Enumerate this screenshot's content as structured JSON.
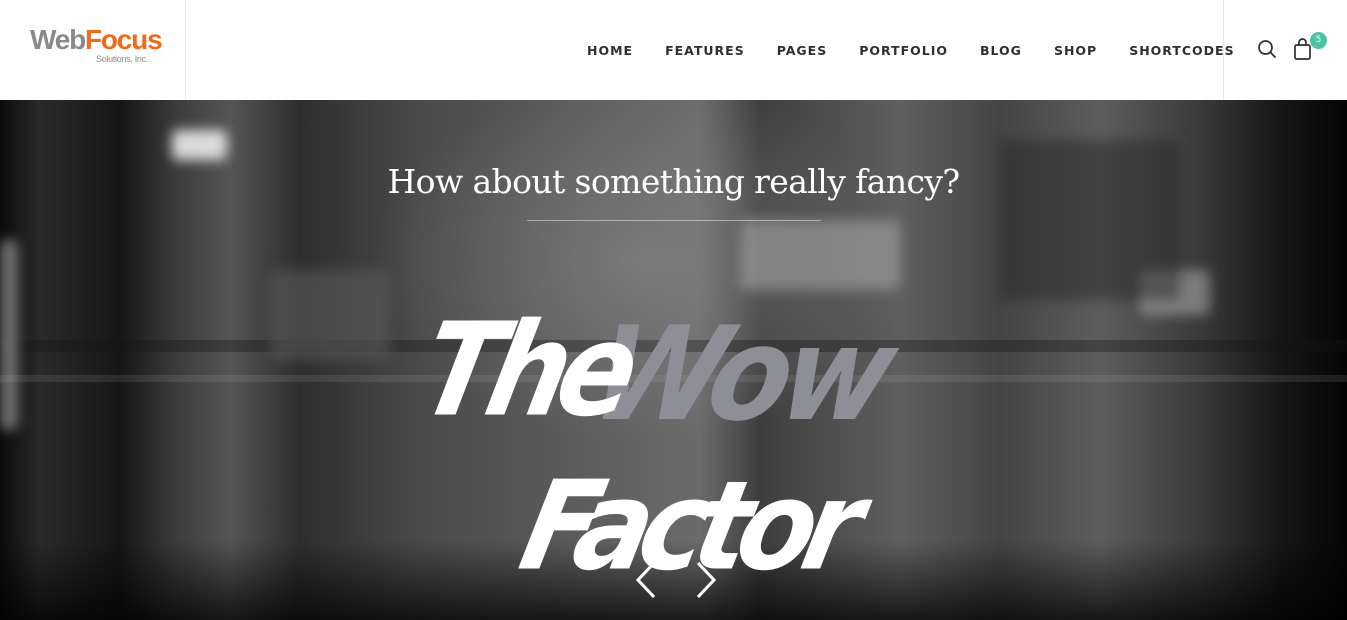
{
  "brand": {
    "name_part1": "Web",
    "name_part2": "Focus",
    "tagline": "Solutions, Inc."
  },
  "nav": {
    "items": [
      {
        "label": "HOME"
      },
      {
        "label": "FEATURES"
      },
      {
        "label": "PAGES"
      },
      {
        "label": "PORTFOLIO"
      },
      {
        "label": "BLOG"
      },
      {
        "label": "SHOP"
      },
      {
        "label": "SHORTCODES"
      }
    ]
  },
  "utility": {
    "search_icon": "search-icon",
    "cart_icon": "shopping-bag-icon",
    "cart_count": "5"
  },
  "hero": {
    "heading": "How about something really fancy?",
    "headline_word1": "The",
    "headline_word2": "Wow",
    "headline_word3": "Factor",
    "prev_icon": "chevron-left-icon",
    "next_icon": "chevron-right-icon"
  },
  "colors": {
    "brand_gray": "#8a8a8a",
    "brand_orange": "#f06a1c",
    "badge": "#4fc1a6",
    "nav_text": "#2f2f2f",
    "wow_gray": "#8e8e96"
  }
}
